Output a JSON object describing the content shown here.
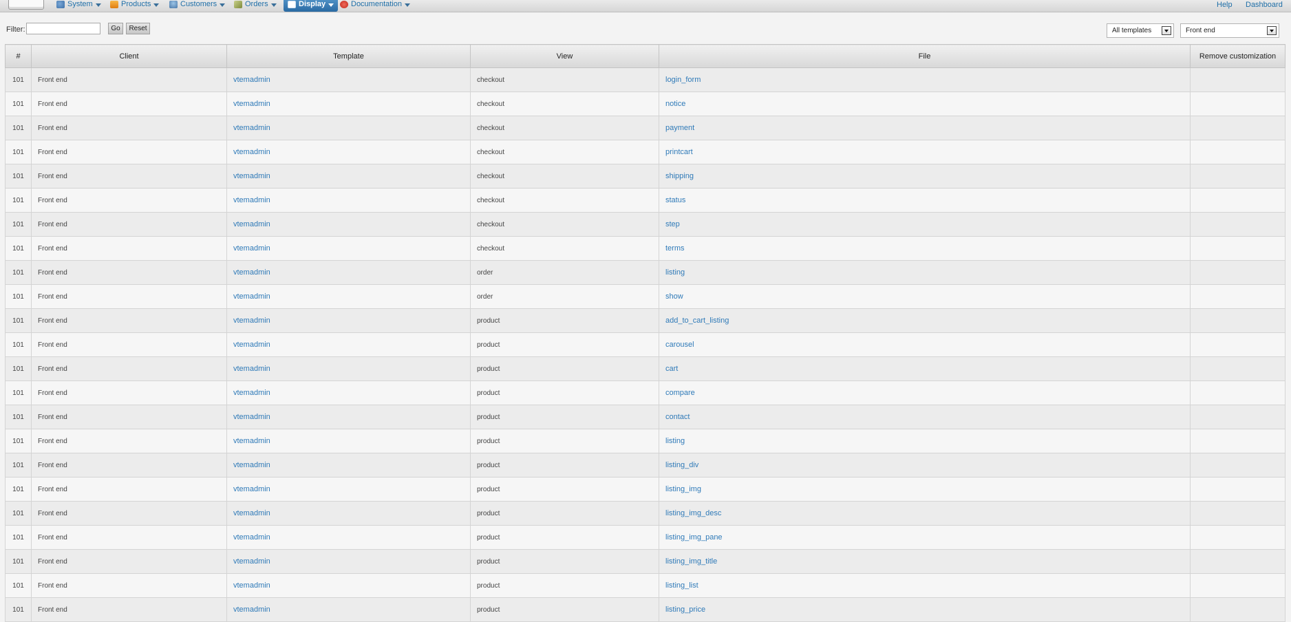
{
  "menu": {
    "items": [
      {
        "label": "System",
        "icon": "system-icon"
      },
      {
        "label": "Products",
        "icon": "products-icon"
      },
      {
        "label": "Customers",
        "icon": "customers-icon"
      },
      {
        "label": "Orders",
        "icon": "orders-icon"
      },
      {
        "label": "Display",
        "icon": "display-icon",
        "active": true
      },
      {
        "label": "Documentation",
        "icon": "documentation-icon"
      }
    ],
    "help": "Help",
    "dashboard": "Dashboard"
  },
  "filter": {
    "label": "Filter:",
    "value": "",
    "go": "Go",
    "reset": "Reset",
    "template_select": "All templates",
    "client_select": "Front end"
  },
  "table": {
    "headers": {
      "num": "#",
      "client": "Client",
      "template": "Template",
      "view": "View",
      "file": "File",
      "remove": "Remove customization"
    },
    "rows": [
      {
        "num": "101",
        "client": "Front end",
        "template": "vtemadmin",
        "view": "checkout",
        "file": "login_form"
      },
      {
        "num": "101",
        "client": "Front end",
        "template": "vtemadmin",
        "view": "checkout",
        "file": "notice"
      },
      {
        "num": "101",
        "client": "Front end",
        "template": "vtemadmin",
        "view": "checkout",
        "file": "payment"
      },
      {
        "num": "101",
        "client": "Front end",
        "template": "vtemadmin",
        "view": "checkout",
        "file": "printcart"
      },
      {
        "num": "101",
        "client": "Front end",
        "template": "vtemadmin",
        "view": "checkout",
        "file": "shipping"
      },
      {
        "num": "101",
        "client": "Front end",
        "template": "vtemadmin",
        "view": "checkout",
        "file": "status"
      },
      {
        "num": "101",
        "client": "Front end",
        "template": "vtemadmin",
        "view": "checkout",
        "file": "step"
      },
      {
        "num": "101",
        "client": "Front end",
        "template": "vtemadmin",
        "view": "checkout",
        "file": "terms"
      },
      {
        "num": "101",
        "client": "Front end",
        "template": "vtemadmin",
        "view": "order",
        "file": "listing"
      },
      {
        "num": "101",
        "client": "Front end",
        "template": "vtemadmin",
        "view": "order",
        "file": "show"
      },
      {
        "num": "101",
        "client": "Front end",
        "template": "vtemadmin",
        "view": "product",
        "file": "add_to_cart_listing"
      },
      {
        "num": "101",
        "client": "Front end",
        "template": "vtemadmin",
        "view": "product",
        "file": "carousel"
      },
      {
        "num": "101",
        "client": "Front end",
        "template": "vtemadmin",
        "view": "product",
        "file": "cart"
      },
      {
        "num": "101",
        "client": "Front end",
        "template": "vtemadmin",
        "view": "product",
        "file": "compare"
      },
      {
        "num": "101",
        "client": "Front end",
        "template": "vtemadmin",
        "view": "product",
        "file": "contact"
      },
      {
        "num": "101",
        "client": "Front end",
        "template": "vtemadmin",
        "view": "product",
        "file": "listing"
      },
      {
        "num": "101",
        "client": "Front end",
        "template": "vtemadmin",
        "view": "product",
        "file": "listing_div"
      },
      {
        "num": "101",
        "client": "Front end",
        "template": "vtemadmin",
        "view": "product",
        "file": "listing_img"
      },
      {
        "num": "101",
        "client": "Front end",
        "template": "vtemadmin",
        "view": "product",
        "file": "listing_img_desc"
      },
      {
        "num": "101",
        "client": "Front end",
        "template": "vtemadmin",
        "view": "product",
        "file": "listing_img_pane"
      },
      {
        "num": "101",
        "client": "Front end",
        "template": "vtemadmin",
        "view": "product",
        "file": "listing_img_title"
      },
      {
        "num": "101",
        "client": "Front end",
        "template": "vtemadmin",
        "view": "product",
        "file": "listing_list"
      },
      {
        "num": "101",
        "client": "Front end",
        "template": "vtemadmin",
        "view": "product",
        "file": "listing_price"
      }
    ]
  },
  "colors": {
    "link": "#2f7ab8",
    "menu_active": "#2a6aa3"
  }
}
